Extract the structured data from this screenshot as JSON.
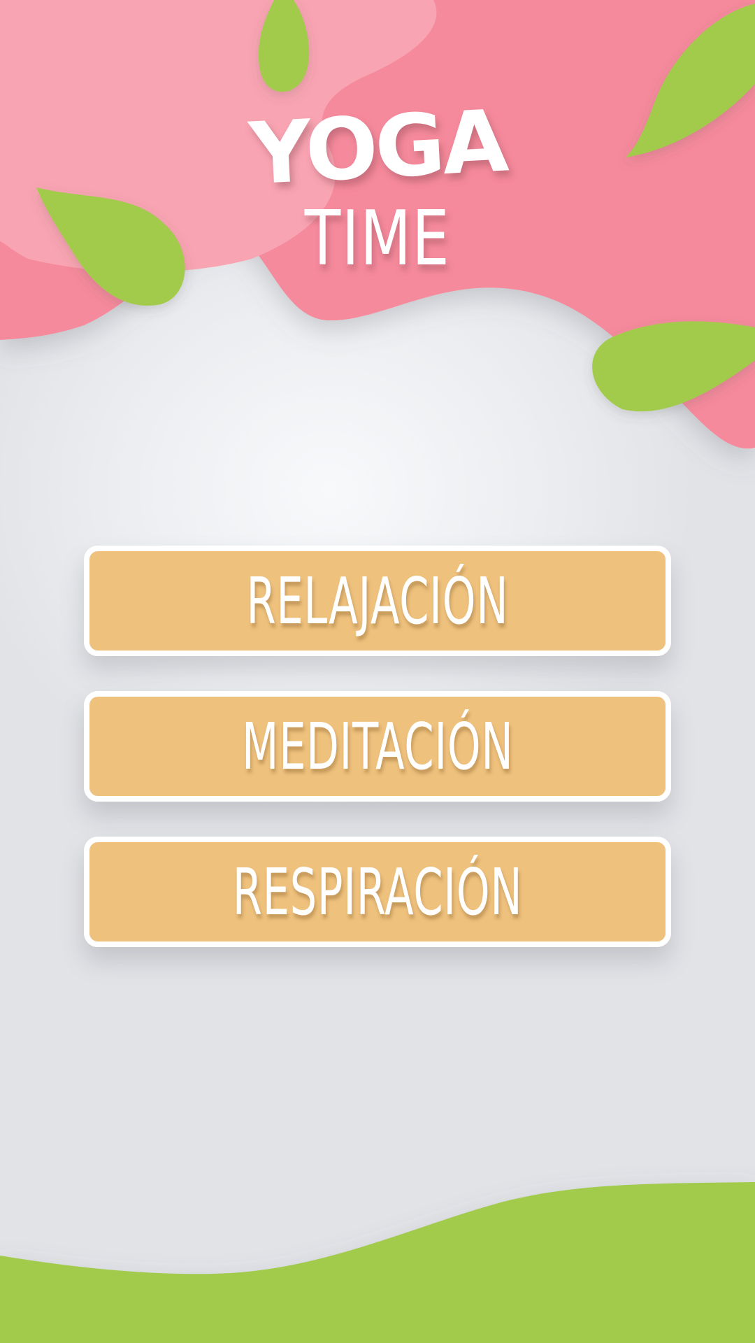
{
  "app": {
    "logo_line1": "YOGA",
    "logo_line2": "TIME"
  },
  "menu": {
    "items": [
      {
        "label": "RELAJACIÓN"
      },
      {
        "label": "MEDITACIÓN"
      },
      {
        "label": "RESPIRACIÓN"
      }
    ]
  },
  "colors": {
    "pink": "#f58a9c",
    "pink_light": "#f9a4b2",
    "leaf_green": "#a2cb4b",
    "button_fill": "#eec17d",
    "button_border": "#ffffff",
    "background": "#e7e8eb",
    "text": "#ffffff"
  },
  "icons": [
    "leaf-icon"
  ]
}
